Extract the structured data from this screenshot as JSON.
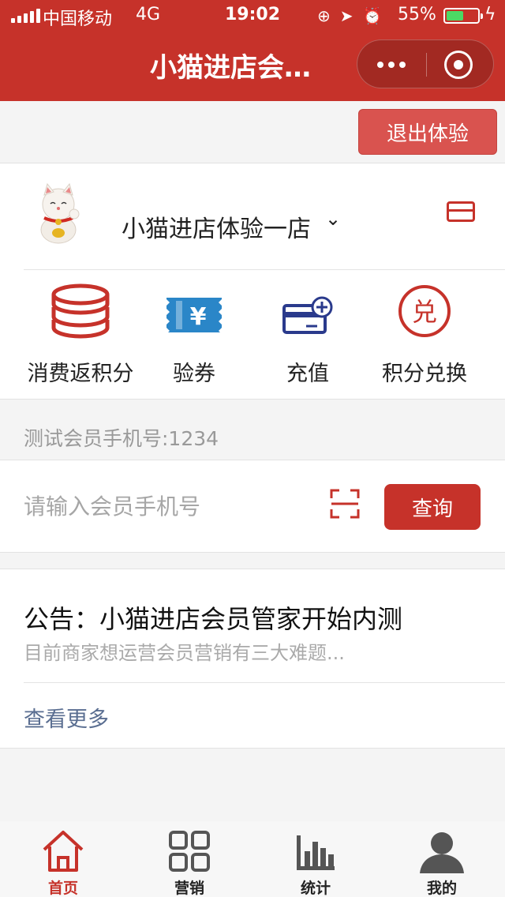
{
  "status_bar": {
    "carrier": "中国移动",
    "network": "4G",
    "time": "19:02",
    "battery_percent": "55%",
    "battery_level": 0.55
  },
  "nav": {
    "title": "小猫进店会…"
  },
  "exit_button": "退出体验",
  "store": {
    "name": "小猫进店体验一店",
    "caret": "⌄"
  },
  "actions": [
    {
      "label": "消费返积分",
      "icon": "coins-stack-icon"
    },
    {
      "label": "验券",
      "icon": "yen-ticket-icon"
    },
    {
      "label": "充值",
      "icon": "card-add-icon"
    },
    {
      "label": "积分兑换",
      "icon": "exchange-icon",
      "glyph": "兑"
    }
  ],
  "test_member": "测试会员手机号:1234",
  "search": {
    "placeholder": "请输入会员手机号",
    "button": "查询"
  },
  "notice": {
    "title": "公告：小猫进店会员管家开始内测",
    "summary": "目前商家想运营会员营销有三大难题...",
    "more": "查看更多"
  },
  "tabs": [
    {
      "label": "首页",
      "icon": "home-icon",
      "active": true
    },
    {
      "label": "营销",
      "icon": "grid-icon",
      "active": false
    },
    {
      "label": "统计",
      "icon": "bar-chart-icon",
      "active": false
    },
    {
      "label": "我的",
      "icon": "person-icon",
      "active": false
    }
  ],
  "colors": {
    "brand_red": "#c6322a",
    "link_blue": "#5a6e91",
    "icon_blue": "#2a86c8",
    "battery_green": "#4cd964"
  }
}
